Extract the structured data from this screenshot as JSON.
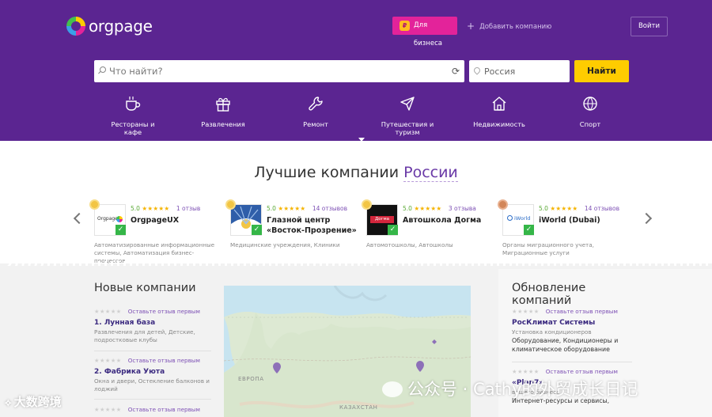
{
  "header": {
    "logo_text": "orgpage",
    "business_label": "Для бизнеса",
    "add_company_label": "Добавить компанию",
    "login_label": "Войти",
    "search_placeholder": "Что найти?",
    "region_placeholder": "Россия",
    "find_label": "Найти"
  },
  "categories": [
    {
      "label": "Рестораны и кафе",
      "icon": "coffee-icon"
    },
    {
      "label": "Развлечения",
      "icon": "gift-icon"
    },
    {
      "label": "Ремонт",
      "icon": "wrench-icon"
    },
    {
      "label": "Путешествия и туризм",
      "icon": "plane-icon"
    },
    {
      "label": "Недвижимость",
      "icon": "house-icon"
    },
    {
      "label": "Спорт",
      "icon": "ball-icon"
    }
  ],
  "best": {
    "title_prefix": "Лучшие компании",
    "title_region": "России",
    "cards": [
      {
        "rating": "5.0",
        "stars": "★★★★★",
        "reviews": "1 отзыв",
        "name": "OrgpageUX",
        "desc": "Автоматизированные информационные системы, Автоматизация бизнес-процессов",
        "thumb_text": "Orgpage",
        "medal": "gold"
      },
      {
        "rating": "5.0",
        "stars": "★★★★★",
        "reviews": "14 отзывов",
        "name": "Глазной центр «Восток-Прозрение»",
        "desc": "Медицинские учреждения, Клиники",
        "thumb_text": "",
        "medal": "gold"
      },
      {
        "rating": "5.0",
        "stars": "★★★★★",
        "reviews": "3 отзыва",
        "name": "Автошкола Догма",
        "desc": "Автомотошколы, Автошколы",
        "thumb_text": "Догма",
        "medal": "gold"
      },
      {
        "rating": "5.0",
        "stars": "★★★★★",
        "reviews": "14 отзывов",
        "name": "iWorld (Dubai)",
        "desc": "Органы миграционного учета, Миграционные услуги",
        "thumb_text": "iWorld",
        "medal": "bronze"
      }
    ]
  },
  "new_companies": {
    "title": "Новые компании",
    "empty_stars": "★★★★★",
    "review_cta": "Оставьте отзыв первым",
    "items": [
      {
        "name": "1. Лунная база",
        "desc": "Развлечения для детей, Детские, подростковые клубы"
      },
      {
        "name": "2. Фабрика Уюта",
        "desc": "Окна и двери, Остекление балконов и лоджий"
      },
      {
        "name": "",
        "desc": ""
      }
    ]
  },
  "updates": {
    "title": "Обновление компаний",
    "empty_stars": "★★★★★",
    "review_cta": "Оставьте отзыв первым",
    "items": [
      {
        "name": "РосКлимат Системы",
        "sub": "Установка кондиционеров",
        "body": "Оборудование, Кондиционеры и климатическое оборудование"
      },
      {
        "name": "«Plan7»",
        "sub": "вашего бизнеса",
        "body": "Интернет-ресурсы и сервисы,"
      }
    ]
  },
  "map": {
    "label_europe": "ЕВРОПА",
    "label_kz": "КАЗАХСТАН"
  },
  "watermark": {
    "left": "大数跨境",
    "right": "公众号 · Cathy的外贸成长日记"
  },
  "colors": {
    "header_bg": "#5b2591",
    "business_bg": "#e3239a",
    "find_bg": "#ffcc00",
    "accent": "#6a3aa7"
  }
}
